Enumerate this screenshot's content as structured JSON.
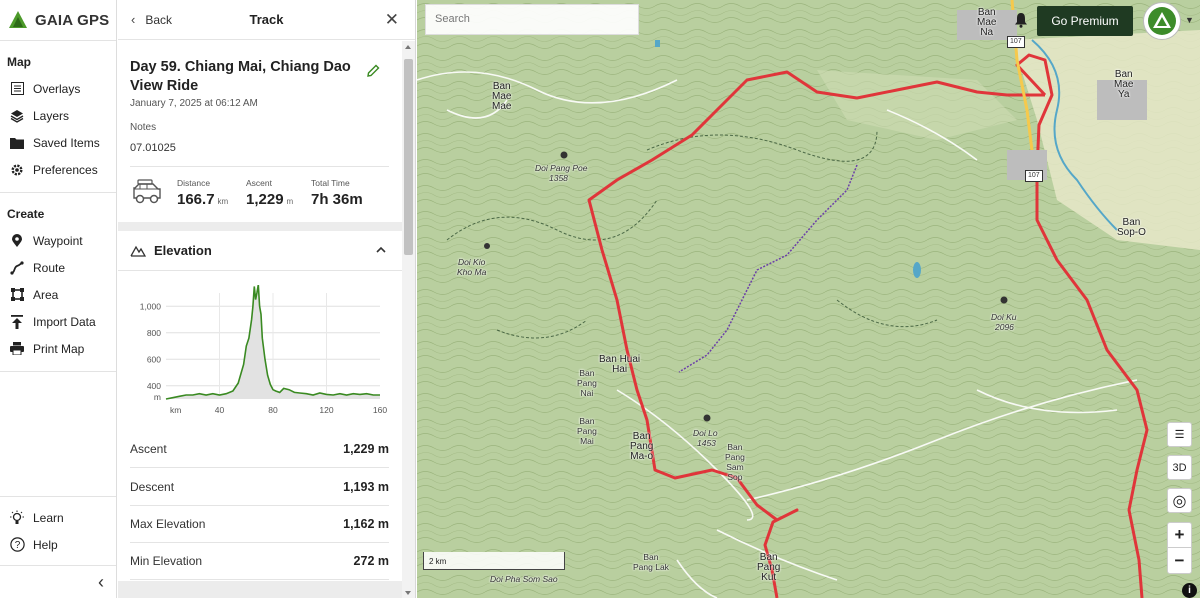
{
  "sidebar": {
    "logo_text": "GAIA GPS",
    "map_heading": "Map",
    "map_items": [
      {
        "label": "Overlays",
        "icon": "overlays-icon"
      },
      {
        "label": "Layers",
        "icon": "layers-icon"
      },
      {
        "label": "Saved Items",
        "icon": "saved-items-icon"
      },
      {
        "label": "Preferences",
        "icon": "gear-icon"
      }
    ],
    "create_heading": "Create",
    "create_items": [
      {
        "label": "Waypoint",
        "icon": "waypoint-icon"
      },
      {
        "label": "Route",
        "icon": "route-icon"
      },
      {
        "label": "Area",
        "icon": "area-icon"
      },
      {
        "label": "Import Data",
        "icon": "import-icon"
      },
      {
        "label": "Print Map",
        "icon": "printer-icon"
      }
    ],
    "bottom_items": [
      {
        "label": "Learn",
        "icon": "lightbulb-icon"
      },
      {
        "label": "Help",
        "icon": "help-icon"
      }
    ],
    "collapse_glyph": "‹"
  },
  "panel": {
    "back_label": "Back",
    "title": "Track",
    "track_name": "Day 59. Chiang Mai, Chiang Dao View Ride",
    "date": "January 7, 2025 at 06:12 AM",
    "notes_label": "Notes",
    "notes_value": "07.01025",
    "stats": {
      "distance_label": "Distance",
      "distance_value": "166.7",
      "distance_unit": "km",
      "ascent_label": "Ascent",
      "ascent_value": "1,229",
      "ascent_unit": "m",
      "time_label": "Total Time",
      "time_value": "7h 36m"
    },
    "elevation_title": "Elevation",
    "metrics": [
      {
        "label": "Ascent",
        "value": "1,229 m"
      },
      {
        "label": "Descent",
        "value": "1,193 m"
      },
      {
        "label": "Max Elevation",
        "value": "1,162 m"
      },
      {
        "label": "Min Elevation",
        "value": "272 m"
      }
    ]
  },
  "chart_data": {
    "type": "area",
    "title": "",
    "xlabel": "km",
    "ylabel": "m",
    "xlim": [
      0,
      160
    ],
    "ylim": [
      300,
      1100
    ],
    "x_ticks": [
      "km",
      "40",
      "80",
      "120",
      "160"
    ],
    "y_ticks": [
      "1,000",
      "800",
      "600",
      "400",
      "m"
    ],
    "series": [
      {
        "name": "",
        "x": [
          0,
          5,
          10,
          15,
          20,
          25,
          30,
          35,
          40,
          45,
          50,
          54,
          58,
          60,
          62,
          64,
          65,
          66,
          67,
          68,
          69,
          70,
          71,
          72,
          74,
          76,
          78,
          80,
          82,
          85,
          88,
          92,
          96,
          100,
          105,
          110,
          115,
          120,
          125,
          130,
          135,
          140,
          145,
          150,
          155,
          160
        ],
        "y": [
          300,
          310,
          320,
          330,
          330,
          340,
          330,
          340,
          330,
          340,
          360,
          420,
          560,
          700,
          760,
          900,
          1000,
          1150,
          1050,
          1100,
          1162,
          1000,
          940,
          760,
          600,
          480,
          410,
          370,
          360,
          350,
          380,
          370,
          350,
          345,
          340,
          330,
          345,
          335,
          330,
          340,
          330,
          340,
          335,
          340,
          330,
          330
        ]
      }
    ],
    "fill_color": "#e2e2e2",
    "line_color": "#3a8a22"
  },
  "map": {
    "search_placeholder": "Search",
    "premium_label": "Go Premium",
    "ctrl_list": "☰",
    "ctrl_3d": "3D",
    "ctrl_locate": "◎",
    "zoom_in": "+",
    "zoom_out": "−",
    "scale_label": "2 km",
    "info_glyph": "i",
    "route_color": "#e0353a",
    "labels": {
      "ban_mae_na": "Ban\nMae\nNa",
      "ban_mae_ya": "Ban\nMae\nYa",
      "ban_mae_mae": "Ban\nMae\nMae",
      "doi_pang_poe": "Doi Pang Poe",
      "doi_pang_poe_elev": "1358",
      "ban_sop_o": "Ban\nSop-O",
      "doi_kio_kho_ma": "Doi Kio\nKho Ma",
      "ban_huai_hai": "Ban Huai\nHai",
      "ban_pang_nai": "Ban\nPang\nNai",
      "ban_pang_mai": "Ban\nPang\nMai",
      "ban_pang_ma_o": "Ban\nPang\nMa-o",
      "doi_lo": "Doi Lo",
      "doi_lo_elev": "1453",
      "ban_pang_sam_sop": "Ban\nPang\nSam\nSop",
      "doi_ku": "Doi Ku",
      "doi_ku_elev": "2096",
      "ban_pang_lak": "Ban\nPang Lak",
      "ban_pang_kut": "Ban\nPang\nKut",
      "doi_pha_som_sao": "Doi Pha Som Sao",
      "road_107_a": "107",
      "road_107_b": "107"
    }
  }
}
